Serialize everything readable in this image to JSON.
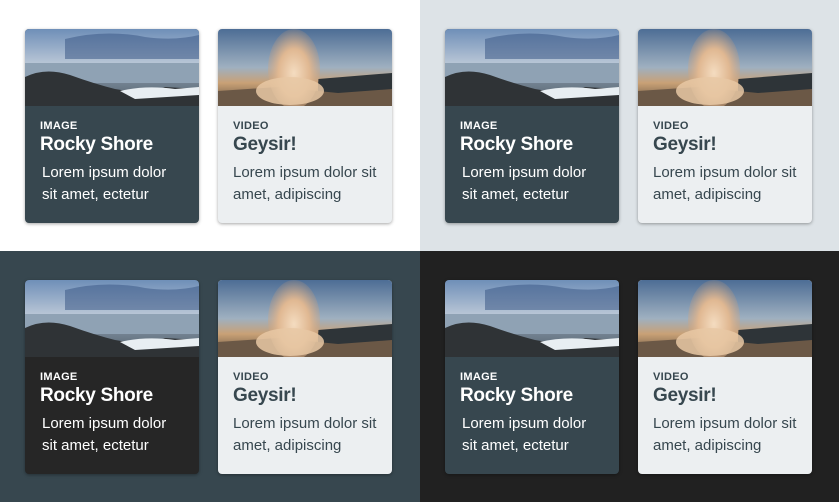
{
  "colors": {
    "bg_white": "#ffffff",
    "bg_light": "#dde3e7",
    "bg_slate": "#37474f",
    "bg_black": "#212121",
    "card_dark_slate": "#37474f",
    "card_black": "#262626",
    "card_light": "#eceff1",
    "text_dark": "#37474f"
  },
  "quadrants": [
    {
      "image_card": {
        "kind": "IMAGE",
        "title": "Rocky Shore",
        "text": "Lorem ipsum dolor sit amet, ectetur"
      },
      "video_card": {
        "kind": "VIDEO",
        "title": "Geysir!",
        "text": "Lorem ipsum dolor sit amet, adipiscing"
      }
    },
    {
      "image_card": {
        "kind": "IMAGE",
        "title": "Rocky Shore",
        "text": "Lorem ipsum dolor sit amet, ectetur"
      },
      "video_card": {
        "kind": "VIDEO",
        "title": "Geysir!",
        "text": "Lorem ipsum dolor sit amet, adipiscing"
      }
    },
    {
      "image_card": {
        "kind": "IMAGE",
        "title": "Rocky Shore",
        "text": "Lorem ipsum dolor sit amet, ectetur"
      },
      "video_card": {
        "kind": "VIDEO",
        "title": "Geysir!",
        "text": "Lorem ipsum dolor sit amet, adipiscing"
      }
    },
    {
      "image_card": {
        "kind": "IMAGE",
        "title": "Rocky Shore",
        "text": "Lorem ipsum dolor sit amet, ectetur"
      },
      "video_card": {
        "kind": "VIDEO",
        "title": "Geysir!",
        "text": "Lorem ipsum dolor sit amet, adipiscing"
      }
    }
  ]
}
